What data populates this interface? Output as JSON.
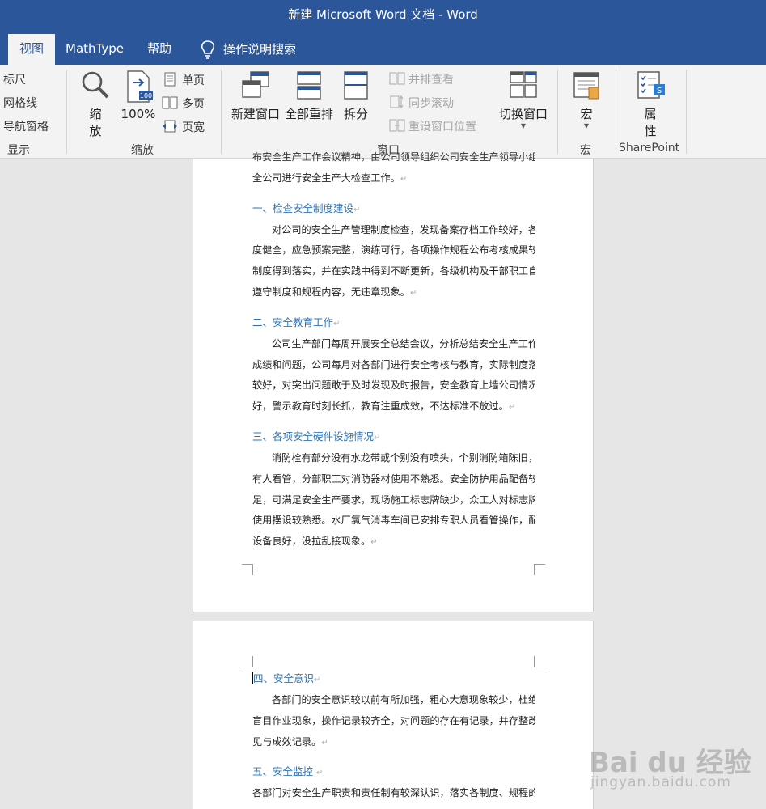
{
  "window": {
    "title": "新建 Microsoft Word 文档  -  Word"
  },
  "tabs": [
    {
      "label": "视图",
      "active": true
    },
    {
      "label": "MathType"
    },
    {
      "label": "帮助"
    },
    {
      "label": "操作说明搜索"
    }
  ],
  "ribbon": {
    "show": {
      "items": [
        "标尺",
        "网格线",
        "导航窗格"
      ],
      "label": "显示"
    },
    "zoom": {
      "zoom_btn_line1": "缩",
      "zoom_btn_line2": "放",
      "percent": "100%",
      "single": "单页",
      "multi": "多页",
      "width": "页宽",
      "label": "缩放"
    },
    "window": {
      "new_window": "新建窗口",
      "arrange_all": "全部重排",
      "split": "拆分",
      "side_by_side": "并排查看",
      "sync_scroll": "同步滚动",
      "reset_pos": "重设窗口位置",
      "switch": "切换窗口",
      "label": "窗口"
    },
    "macros": {
      "btn": "宏",
      "label": "宏"
    },
    "sharepoint": {
      "btn_line1": "属",
      "btn_line2": "性",
      "label": "SharePoint"
    }
  },
  "document": {
    "top_lines": [
      "布安全生产工作会议精神，由公司领导组织公司安全生产领导小组对",
      "全公司进行安全生产大检查工作。"
    ],
    "h1": "一、检查安全制度建设",
    "p1": [
      "对公司的安全生产管理制度检查，发现备案存档工作较好，各制",
      "度健全，应急预案完整，演练可行，各项操作规程公布考核成果较好，",
      "制度得到落实，并在实践中得到不断更新，各级机构及干部职工自觉",
      "遵守制度和规程内容，无违章现象。"
    ],
    "h2": "二、安全教育工作",
    "p2": [
      "公司生产部门每周开展安全总结会议，分析总结安全生产工作的",
      "成绩和问题，公司每月对各部门进行安全考核与教育，实际制度落实",
      "较好，对突出问题敢于及时发现及时报告，安全教育上墙公司情况良",
      "好，警示教育时刻长抓，教育注重成效，不达标准不放过。"
    ],
    "h3": "三、各项安全硬件设施情况",
    "p3": [
      "消防栓有部分没有水龙带或个别没有喷头，个别消防箱陈旧，没",
      "有人看管，分部职工对消防器材使用不熟悉。安全防护用品配备较充",
      "足，可满足安全生产要求，现场施工标志牌缺少，众工人对标志牌的",
      "使用摆设较熟悉。水厂氯气消毒车间已安排专职人员看管操作，配电",
      "设备良好，没拉乱接现象。"
    ],
    "h4": "四、安全意识",
    "p4": [
      "各部门的安全意识较以前有所加强，粗心大意现象较少，杜绝了",
      "盲目作业现象，操作记录较齐全，对问题的存在有记录，并存整改意",
      "见与成效记录。"
    ],
    "h5": "五、安全监控",
    "p5": [
      "各部门对安全生产职责和责任制有较深认识，落实各制度、规程的自"
    ]
  },
  "watermark": {
    "brand": "Bai du 经验",
    "url": "jingyan.baidu.com"
  }
}
